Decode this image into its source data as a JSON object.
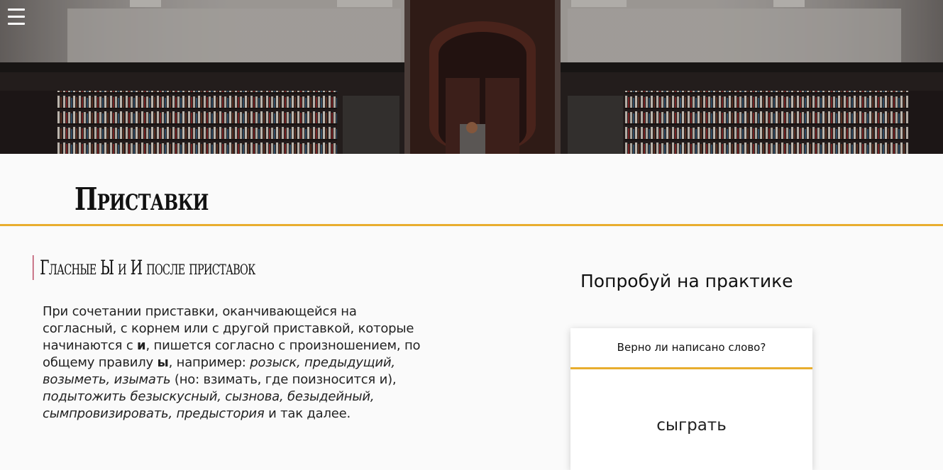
{
  "header": {
    "menu_icon": "hamburger-menu-icon",
    "image": "library-bookshelves-photo"
  },
  "page": {
    "title": "Приставки"
  },
  "section": {
    "heading": "Гласные Ы и И после приставок",
    "text": {
      "p1": "При сочетании приставки, оканчивающейся на согласный, с корнем или с другой приставкой, которые начинаются с ",
      "b1": "и",
      "p2": ", пишется согласно с произношением, по общему правилу ",
      "b2": "ы",
      "p3": ", например: ",
      "i1": "розыск, предыдущий, возыметь, изымать",
      "p4": " (но: взимать, где поизносится и), ",
      "i2": "подытожить безыскусный, сызнова, безыдейный, сымпровизировать, предыстория",
      "p5": " и так далее."
    }
  },
  "practice": {
    "heading": "Попробуй на практике",
    "card": {
      "question": "Верно ли написано слово?",
      "word": "сыграть"
    }
  },
  "colors": {
    "accent": "#e8ad2e",
    "heading_bar": "#b8455f",
    "background": "#fafafa"
  }
}
